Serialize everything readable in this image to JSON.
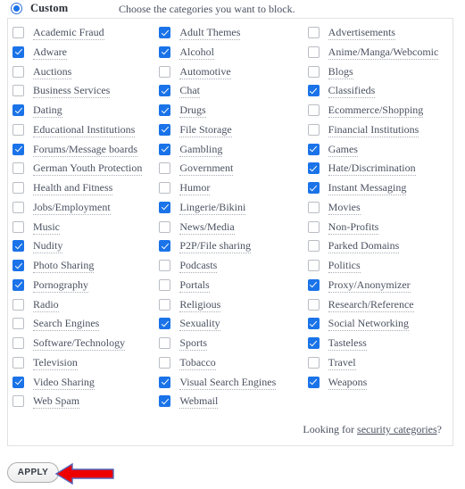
{
  "header": {
    "radio_label": "Custom",
    "radio_selected": true,
    "instruction": "Choose the categories you want to block."
  },
  "colors": {
    "accent": "#1a73e8",
    "checkbox_border": "#b9bdc4",
    "panel_border": "#e2e2e2",
    "text": "#4a5160",
    "arrow_fill": "#ee0000",
    "arrow_stroke": "#5566bb"
  },
  "categories": {
    "columns": [
      {
        "items": [
          {
            "label": "Academic Fraud",
            "checked": false
          },
          {
            "label": "Adware",
            "checked": true
          },
          {
            "label": "Auctions",
            "checked": false
          },
          {
            "label": "Business Services",
            "checked": false
          },
          {
            "label": "Dating",
            "checked": true
          },
          {
            "label": "Educational Institutions",
            "checked": false
          },
          {
            "label": "Forums/Message boards",
            "checked": true
          },
          {
            "label": "German Youth Protection",
            "checked": false
          },
          {
            "label": "Health and Fitness",
            "checked": false
          },
          {
            "label": "Jobs/Employment",
            "checked": false
          },
          {
            "label": "Music",
            "checked": false
          },
          {
            "label": "Nudity",
            "checked": true
          },
          {
            "label": "Photo Sharing",
            "checked": true
          },
          {
            "label": "Pornography",
            "checked": true
          },
          {
            "label": "Radio",
            "checked": false
          },
          {
            "label": "Search Engines",
            "checked": false
          },
          {
            "label": "Software/Technology",
            "checked": false
          },
          {
            "label": "Television",
            "checked": false
          },
          {
            "label": "Video Sharing",
            "checked": true
          },
          {
            "label": "Web Spam",
            "checked": false
          }
        ]
      },
      {
        "items": [
          {
            "label": "Adult Themes",
            "checked": true
          },
          {
            "label": "Alcohol",
            "checked": true
          },
          {
            "label": "Automotive",
            "checked": false
          },
          {
            "label": "Chat",
            "checked": true
          },
          {
            "label": "Drugs",
            "checked": true
          },
          {
            "label": "File Storage",
            "checked": true
          },
          {
            "label": "Gambling",
            "checked": true
          },
          {
            "label": "Government",
            "checked": false
          },
          {
            "label": "Humor",
            "checked": false
          },
          {
            "label": "Lingerie/Bikini",
            "checked": true
          },
          {
            "label": "News/Media",
            "checked": false
          },
          {
            "label": "P2P/File sharing",
            "checked": true
          },
          {
            "label": "Podcasts",
            "checked": false
          },
          {
            "label": "Portals",
            "checked": false
          },
          {
            "label": "Religious",
            "checked": false
          },
          {
            "label": "Sexuality",
            "checked": true
          },
          {
            "label": "Sports",
            "checked": false
          },
          {
            "label": "Tobacco",
            "checked": false
          },
          {
            "label": "Visual Search Engines",
            "checked": true
          },
          {
            "label": "Webmail",
            "checked": true
          }
        ]
      },
      {
        "items": [
          {
            "label": "Advertisements",
            "checked": false
          },
          {
            "label": "Anime/Manga/Webcomic",
            "checked": false
          },
          {
            "label": "Blogs",
            "checked": false
          },
          {
            "label": "Classifieds",
            "checked": true
          },
          {
            "label": "Ecommerce/Shopping",
            "checked": false
          },
          {
            "label": "Financial Institutions",
            "checked": false
          },
          {
            "label": "Games",
            "checked": true
          },
          {
            "label": "Hate/Discrimination",
            "checked": true
          },
          {
            "label": "Instant Messaging",
            "checked": true
          },
          {
            "label": "Movies",
            "checked": false
          },
          {
            "label": "Non-Profits",
            "checked": false
          },
          {
            "label": "Parked Domains",
            "checked": false
          },
          {
            "label": "Politics",
            "checked": false
          },
          {
            "label": "Proxy/Anonymizer",
            "checked": true
          },
          {
            "label": "Research/Reference",
            "checked": false
          },
          {
            "label": "Social Networking",
            "checked": true
          },
          {
            "label": "Tasteless",
            "checked": true
          },
          {
            "label": "Travel",
            "checked": false
          },
          {
            "label": "Weapons",
            "checked": true
          }
        ]
      }
    ]
  },
  "footer": {
    "security_prefix": "Looking for ",
    "security_link": "security categories",
    "security_suffix": "?"
  },
  "actions": {
    "apply_label": "APPLY"
  }
}
